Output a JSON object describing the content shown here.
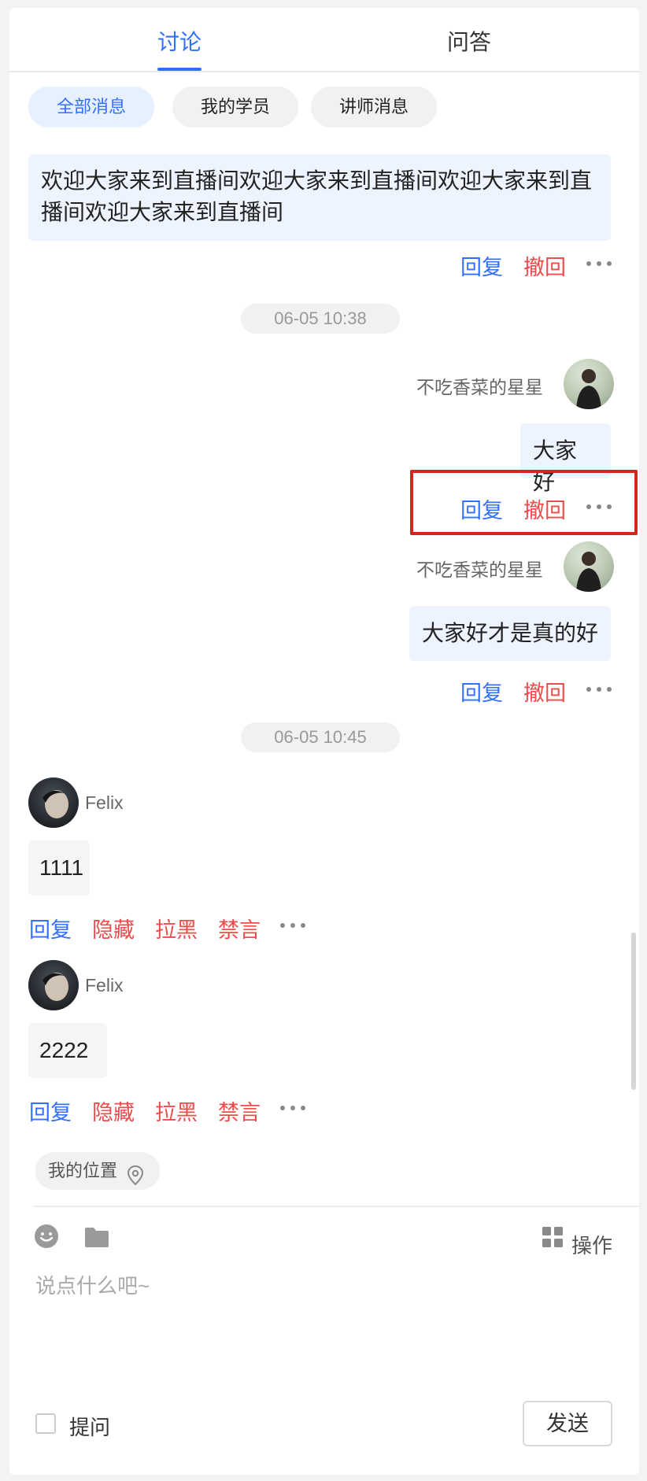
{
  "tabs": [
    {
      "label": "讨论",
      "active": true
    },
    {
      "label": "问答",
      "active": false
    }
  ],
  "filters": [
    {
      "label": "全部消息",
      "active": true
    },
    {
      "label": "我的学员",
      "active": false
    },
    {
      "label": "讲师消息",
      "active": false
    }
  ],
  "messages": {
    "welcome": {
      "line1": "欢迎大家来到直播间欢迎大家来到直播间欢迎大家来到直",
      "line2": "播间欢迎大家来到直播间"
    },
    "time1": "06-05 10:38",
    "msg1": {
      "user": "不吃香菜的星星",
      "text": "大家好"
    },
    "msg2": {
      "user": "不吃香菜的星星",
      "text": "大家好才是真的好"
    },
    "time2": "06-05 10:45",
    "msg3": {
      "user": "Felix",
      "text": "1111"
    },
    "msg4": {
      "user": "Felix",
      "text": "2222"
    }
  },
  "actions": {
    "reply": "回复",
    "recall": "撤回",
    "hide": "隐藏",
    "block": "拉黑",
    "mute": "禁言"
  },
  "composer": {
    "location": "我的位置",
    "operations": "操作",
    "placeholder": "说点什么吧~",
    "ask": "提问",
    "send": "发送"
  },
  "colors": {
    "accent": "#3370ff",
    "danger": "#ee4b4b",
    "highlight": "#d3261f"
  },
  "icons": [
    "smile-icon",
    "folder-icon",
    "grid-icon",
    "location-pin-icon",
    "more-dots-icon"
  ]
}
